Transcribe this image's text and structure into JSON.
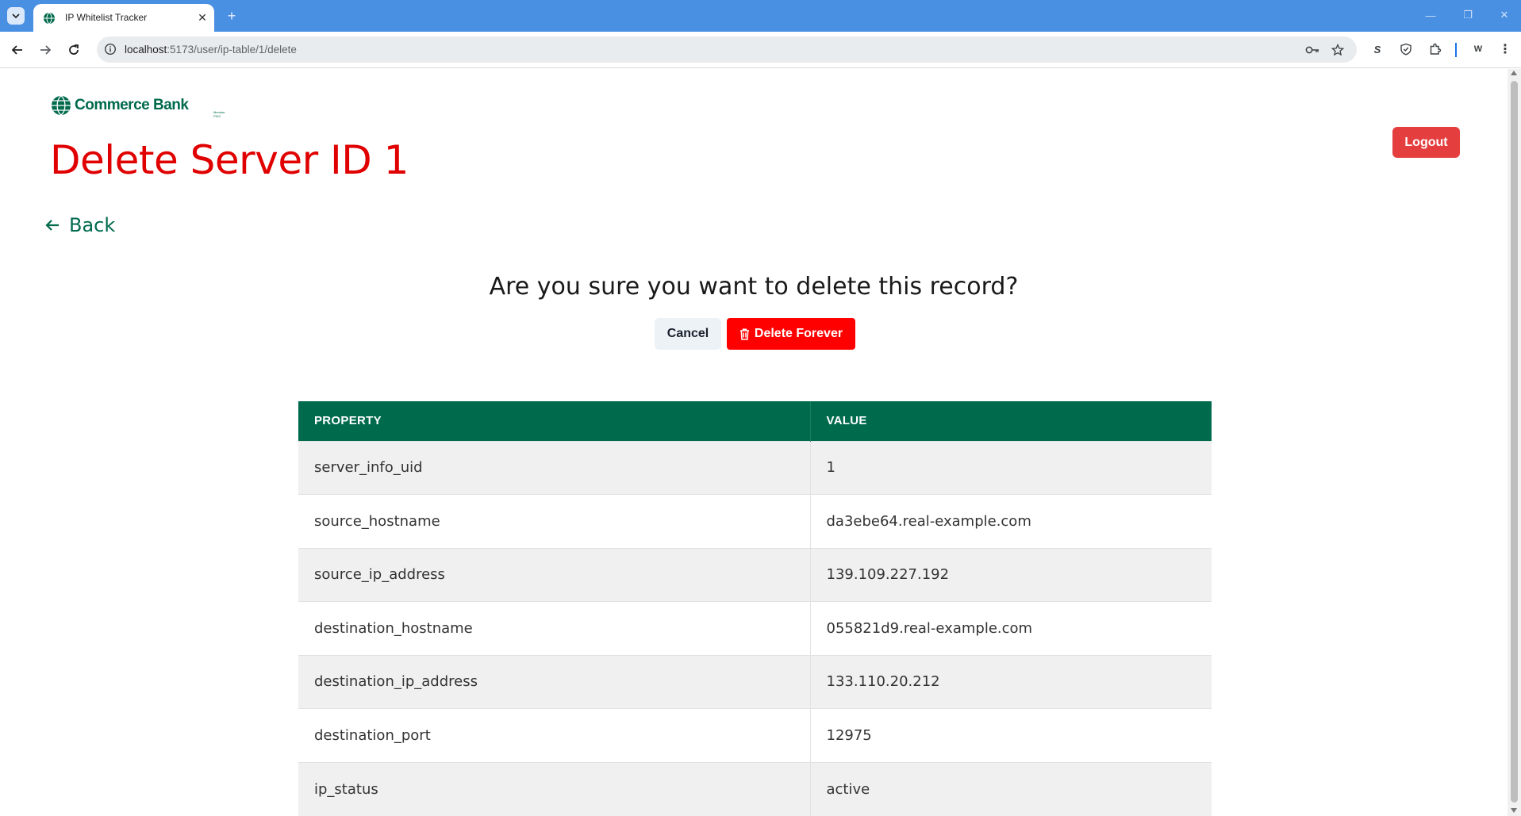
{
  "browser": {
    "tab_title": "IP Whitelist Tracker",
    "url_host": "localhost",
    "url_path": ":5173/user/ip-table/1/delete"
  },
  "brand": {
    "name": "Commerce Bank",
    "sub": "Member FDIC",
    "color": "#006a4d"
  },
  "header": {
    "title": "Delete Server ID 1",
    "logout_label": "Logout"
  },
  "nav": {
    "back_label": "Back"
  },
  "confirm": {
    "question": "Are you sure you want to delete this record?",
    "cancel_label": "Cancel",
    "delete_label": "Delete Forever"
  },
  "table": {
    "headers": [
      "PROPERTY",
      "VALUE"
    ],
    "rows": [
      [
        "server_info_uid",
        "1"
      ],
      [
        "source_hostname",
        "da3ebe64.real-example.com"
      ],
      [
        "source_ip_address",
        "139.109.227.192"
      ],
      [
        "destination_hostname",
        "055821d9.real-example.com"
      ],
      [
        "destination_ip_address",
        "133.110.20.212"
      ],
      [
        "destination_port",
        "12975"
      ],
      [
        "ip_status",
        "active"
      ]
    ]
  },
  "colors": {
    "title_red": "#e00000",
    "delete_red": "#ff0000",
    "logout_red": "#e53e3e",
    "header_green": "#006a4d"
  }
}
